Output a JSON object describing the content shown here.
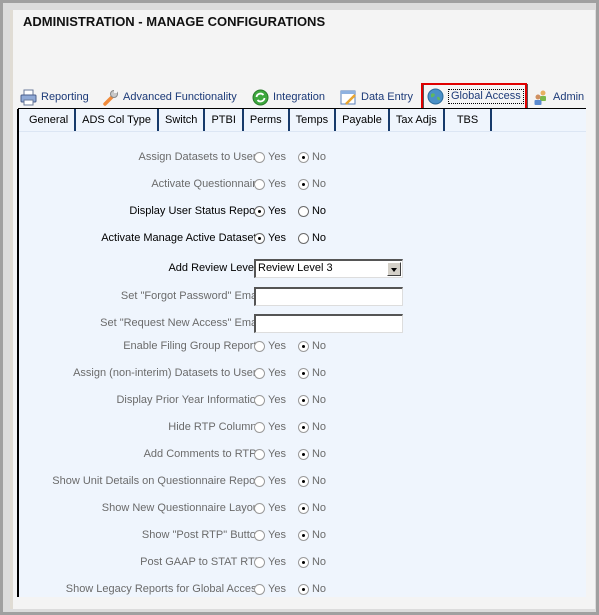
{
  "page": {
    "title": "ADMINISTRATION - MANAGE CONFIGURATIONS"
  },
  "top_tabs": [
    {
      "label": "Reporting",
      "icon": "printer-icon",
      "active": false
    },
    {
      "label": "Advanced Functionality",
      "icon": "wrench-icon",
      "active": false
    },
    {
      "label": "Integration",
      "icon": "refresh-icon",
      "active": false
    },
    {
      "label": "Data Entry",
      "icon": "form-pencil-icon",
      "active": false
    },
    {
      "label": "Global Access",
      "icon": "globe-icon",
      "active": true
    },
    {
      "label": "Admin",
      "icon": "users-icon",
      "active": false
    }
  ],
  "sub_tabs": [
    {
      "label": "General",
      "active": true
    },
    {
      "label": "ADS Col Type",
      "active": false
    },
    {
      "label": "Switch",
      "active": false
    },
    {
      "label": "PTBI",
      "active": false
    },
    {
      "label": "Perms",
      "active": false
    },
    {
      "label": "Temps",
      "active": false
    },
    {
      "label": "Payable",
      "active": false
    },
    {
      "label": "Tax Adjs",
      "active": false
    },
    {
      "label": "TBS",
      "active": false
    }
  ],
  "radio_labels": {
    "yes": "Yes",
    "no": "No"
  },
  "settings": [
    {
      "label": "Assign Datasets to Users",
      "type": "radio",
      "value": "No",
      "enabled": false
    },
    {
      "label": "Activate Questionnaire",
      "type": "radio",
      "value": "No",
      "enabled": false
    },
    {
      "label": "Display User Status Report",
      "type": "radio",
      "value": "Yes",
      "enabled": true
    },
    {
      "label": "Activate Manage Active Datasets",
      "type": "radio",
      "value": "Yes",
      "enabled": true
    },
    {
      "label": "Add Review Levels",
      "type": "select",
      "value": "Review Level 3",
      "enabled": true
    },
    {
      "label": "Set \"Forgot Password\" Email",
      "type": "text",
      "value": "",
      "enabled": false
    },
    {
      "label": "Set \"Request New Access\" Email",
      "type": "text",
      "value": "",
      "enabled": false
    },
    {
      "label": "Enable Filing Group Reports",
      "type": "radio",
      "value": "No",
      "enabled": false
    },
    {
      "label": "Assign (non-interim) Datasets to Users",
      "type": "radio",
      "value": "No",
      "enabled": false
    },
    {
      "label": "Display Prior Year Information",
      "type": "radio",
      "value": "No",
      "enabled": false
    },
    {
      "label": "Hide RTP Columns",
      "type": "radio",
      "value": "No",
      "enabled": false
    },
    {
      "label": "Add Comments to RTPs",
      "type": "radio",
      "value": "No",
      "enabled": false
    },
    {
      "label": "Show Unit Details on Questionnaire Report",
      "type": "radio",
      "value": "No",
      "enabled": false
    },
    {
      "label": "Show New Questionnaire Layout",
      "type": "radio",
      "value": "No",
      "enabled": false
    },
    {
      "label": "Show \"Post RTP\" Button",
      "type": "radio",
      "value": "No",
      "enabled": false
    },
    {
      "label": "Post GAAP to STAT RTP",
      "type": "radio",
      "value": "No",
      "enabled": false
    },
    {
      "label": "Show Legacy Reports for Global Access",
      "type": "radio",
      "value": "No",
      "enabled": false
    }
  ],
  "colors": {
    "highlight": "#e00000",
    "tab_text": "#1c3a78",
    "content_bg": "#eff5fd"
  }
}
